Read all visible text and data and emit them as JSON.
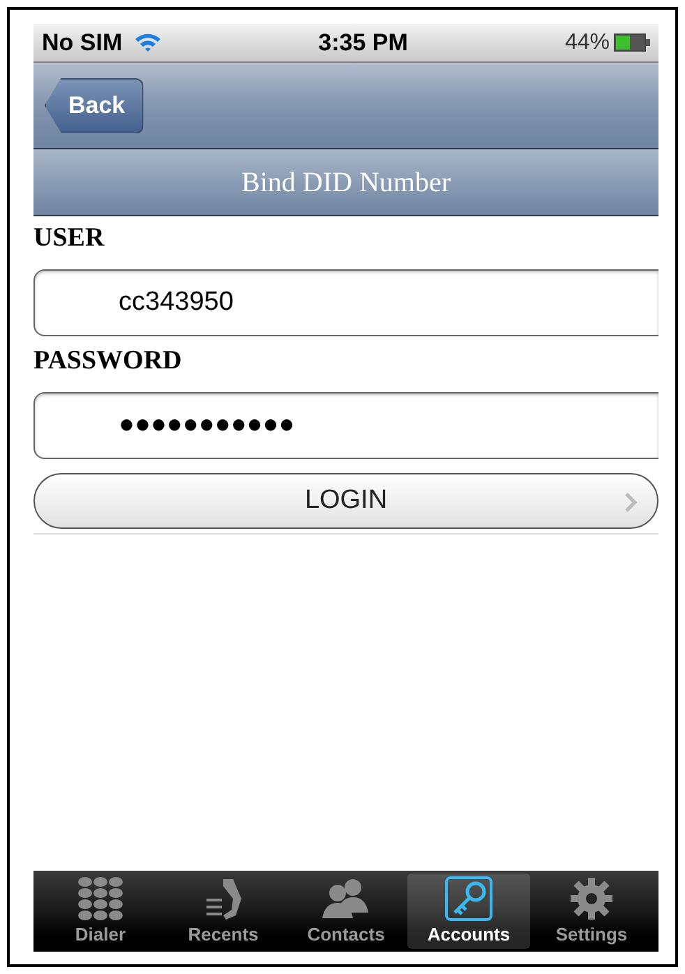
{
  "status_bar": {
    "carrier": "No SIM",
    "time": "3:35 PM",
    "battery": "44%"
  },
  "nav": {
    "back": "Back",
    "title": "Bind DID Number"
  },
  "fields": [
    {
      "label": "USER",
      "value": "cc343950"
    },
    {
      "label": "PASSWORD",
      "value": "●●●●●●●●●●●"
    }
  ],
  "button": "LOGIN",
  "tabs": [
    {
      "label": "Dialer",
      "selected": false
    },
    {
      "label": "Recents",
      "selected": false
    },
    {
      "label": "Contacts",
      "selected": false
    },
    {
      "label": "Accounts",
      "selected": true
    },
    {
      "label": "Settings",
      "selected": false
    }
  ]
}
